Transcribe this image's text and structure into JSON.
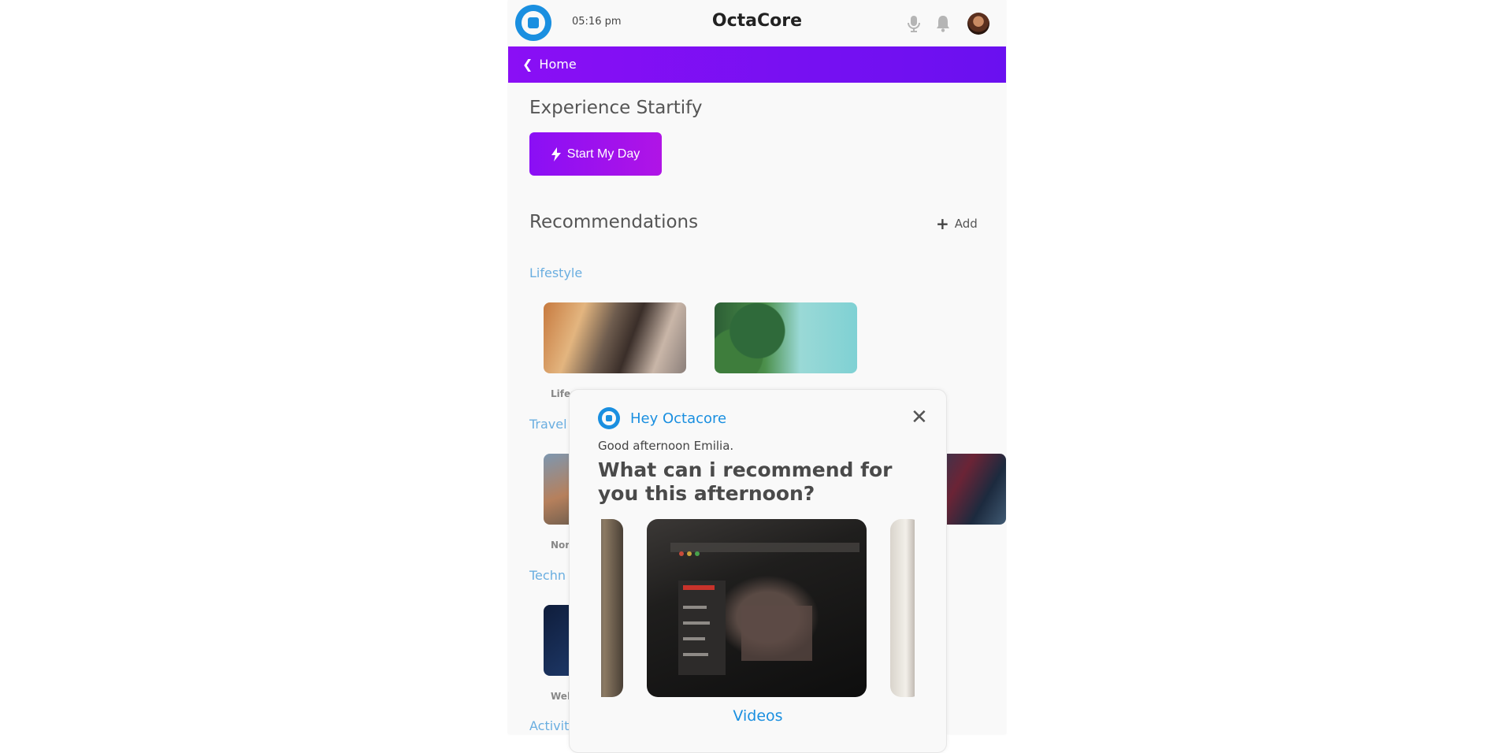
{
  "header": {
    "time": "05:16 pm",
    "title": "OctaCore"
  },
  "nav": {
    "back_label": "Home"
  },
  "experience": {
    "title": "Experience Startify",
    "start_button": "Start My Day"
  },
  "recommendations": {
    "title": "Recommendations",
    "add_label": "Add",
    "categories": [
      {
        "name": "Lifestyle",
        "item_labels": [
          "Lifes"
        ]
      },
      {
        "name": "Travel",
        "item_labels": [
          "Nor"
        ]
      },
      {
        "name": "Techn",
        "item_labels": [
          "Wel"
        ]
      },
      {
        "name": "Activit"
      }
    ]
  },
  "modal": {
    "title": "Hey Octacore",
    "greeting": "Good afternoon Emilia.",
    "question": "What can i recommend for you this afternoon?",
    "active_category": "Videos",
    "close_label": "✕"
  },
  "colors": {
    "brand_purple": "#8a0ff5",
    "brand_blue": "#1a8fe0",
    "category_blue": "#6aaee0"
  }
}
